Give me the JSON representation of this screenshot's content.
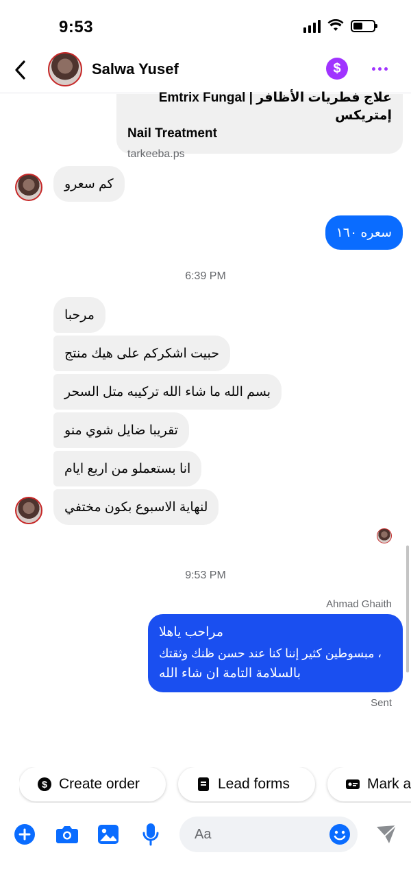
{
  "status_bar": {
    "time": "9:53"
  },
  "header": {
    "contact_name": "Salwa Yusef",
    "dollar_symbol": "$"
  },
  "link_preview": {
    "title_line1": "Emtrix Fungal | علاج فطريات الأظافر إمتريكس",
    "title_line2": "Nail Treatment",
    "domain": "tarkeeba.ps"
  },
  "messages": {
    "incoming_price_question": "كم سعرو",
    "outgoing_price": "سعره ١٦٠",
    "timestamp_1": "6:39 PM",
    "incoming_group": [
      "مرحبا",
      "حبيت اشكركم على هيك منتج",
      "بسم الله ما شاء الله تركيبه متل السحر",
      "تقريبا ضايل شوي منو",
      "انا بستعملو من اربع ايام",
      "لنهاية الاسبوع بكون مختفي"
    ],
    "timestamp_2": "9:53 PM",
    "sender_name": "Ahmad Ghaith",
    "outgoing_reply_lines": [
      "مراحب ياهلا",
      "، مبسوطين كثير إننا كنا عند حسن ظنك وثقتك",
      "بالسلامة التامة ان شاء الله"
    ],
    "sent_status": "Sent"
  },
  "quick_actions": [
    {
      "label": "Create order",
      "icon": "dollar-circle-icon"
    },
    {
      "label": "Lead forms",
      "icon": "form-document-icon"
    },
    {
      "label": "Mark a",
      "icon": "label-tag-icon"
    }
  ],
  "composer": {
    "placeholder": "Aa"
  },
  "colors": {
    "messenger_blue": "#0a6cff",
    "purple_accent": "#a033ff",
    "bubble_gray": "#f0f0f0"
  }
}
